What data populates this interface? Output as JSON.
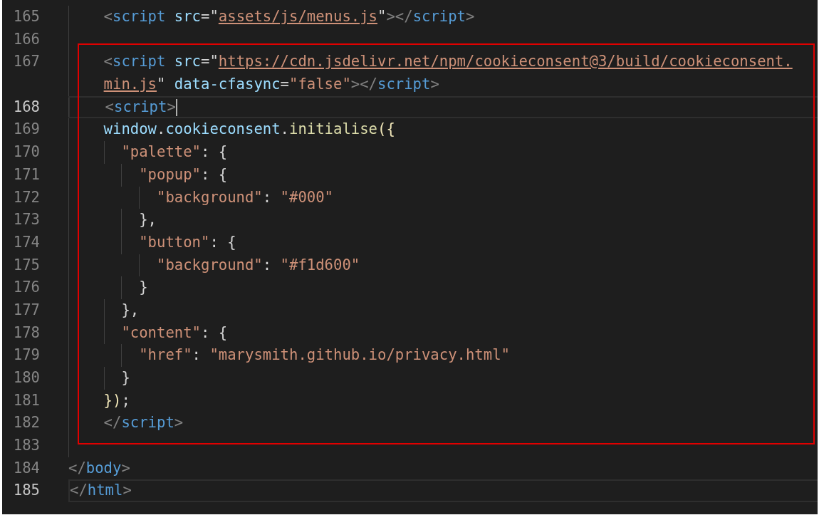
{
  "editor": {
    "blocks": [
      {
        "kind": "plain",
        "lines": [
          {
            "number": "165",
            "current": false,
            "caret": false,
            "tokens": [
              {
                "kind": "punct",
                "text": "    <"
              },
              {
                "kind": "tag",
                "text": "script"
              },
              {
                "kind": "attr",
                "text": " src"
              },
              {
                "kind": "plain",
                "text": "=\""
              },
              {
                "kind": "link",
                "text": "assets/js/menus.js"
              },
              {
                "kind": "plain",
                "text": "\""
              },
              {
                "kind": "punct",
                "text": "></"
              },
              {
                "kind": "tag",
                "text": "script"
              },
              {
                "kind": "punct",
                "text": ">"
              }
            ]
          },
          {
            "number": "166",
            "current": false,
            "caret": false
          }
        ]
      },
      {
        "kind": "framed",
        "lines": [
          {
            "number": "167",
            "current": false,
            "caret": false,
            "tokens": [
              {
                "kind": "punct",
                "text": "    <"
              },
              {
                "kind": "tag",
                "text": "script"
              },
              {
                "kind": "attr",
                "text": " src"
              },
              {
                "kind": "plain",
                "text": "=\""
              },
              {
                "kind": "link",
                "text": "https://cdn.jsdelivr.net/npm/cookieconsent@3/build/cookieconsent."
              }
            ],
            "wrap_tokens": [
              {
                "kind": "link",
                "text": "    min.js"
              },
              {
                "kind": "plain",
                "text": "\""
              },
              {
                "kind": "attr",
                "text": " data-cfasync"
              },
              {
                "kind": "plain",
                "text": "="
              },
              {
                "kind": "string",
                "text": "\"false\""
              },
              {
                "kind": "punct",
                "text": "></"
              },
              {
                "kind": "tag",
                "text": "script"
              },
              {
                "kind": "punct",
                "text": ">"
              }
            ]
          },
          {
            "number": "168",
            "current": true,
            "caret": true,
            "tokens": [
              {
                "kind": "punct",
                "text": "    <"
              },
              {
                "kind": "tag",
                "text": "script"
              },
              {
                "kind": "punct",
                "text": ">"
              }
            ]
          },
          {
            "number": "169",
            "current": false,
            "caret": false,
            "tokens": [
              {
                "kind": "var",
                "text": "    window"
              },
              {
                "kind": "plain",
                "text": "."
              },
              {
                "kind": "var",
                "text": "cookieconsent"
              },
              {
                "kind": "plain",
                "text": "."
              },
              {
                "kind": "func",
                "text": "initialise"
              },
              {
                "kind": "bracket",
                "text": "({"
              }
            ]
          },
          {
            "number": "170",
            "current": false,
            "caret": false,
            "tokens": [
              {
                "kind": "string",
                "text": "      \"palette\""
              },
              {
                "kind": "plain",
                "text": ": {"
              }
            ]
          },
          {
            "number": "171",
            "current": false,
            "caret": false,
            "tokens": [
              {
                "kind": "string",
                "text": "        \"popup\""
              },
              {
                "kind": "plain",
                "text": ": {"
              }
            ]
          },
          {
            "number": "172",
            "current": false,
            "caret": false,
            "tokens": [
              {
                "kind": "string",
                "text": "          \"background\""
              },
              {
                "kind": "plain",
                "text": ": "
              },
              {
                "kind": "string",
                "text": "\"#000\""
              }
            ]
          },
          {
            "number": "173",
            "current": false,
            "caret": false,
            "tokens": [
              {
                "kind": "plain",
                "text": "        },"
              }
            ]
          },
          {
            "number": "174",
            "current": false,
            "caret": false,
            "tokens": [
              {
                "kind": "string",
                "text": "        \"button\""
              },
              {
                "kind": "plain",
                "text": ": {"
              }
            ]
          },
          {
            "number": "175",
            "current": false,
            "caret": false,
            "tokens": [
              {
                "kind": "string",
                "text": "          \"background\""
              },
              {
                "kind": "plain",
                "text": ": "
              },
              {
                "kind": "string",
                "text": "\"#f1d600\""
              }
            ]
          },
          {
            "number": "176",
            "current": false,
            "caret": false,
            "tokens": [
              {
                "kind": "plain",
                "text": "        }"
              }
            ]
          },
          {
            "number": "177",
            "current": false,
            "caret": false,
            "tokens": [
              {
                "kind": "plain",
                "text": "      },"
              }
            ]
          },
          {
            "number": "178",
            "current": false,
            "caret": false,
            "tokens": [
              {
                "kind": "string",
                "text": "      \"content\""
              },
              {
                "kind": "plain",
                "text": ": {"
              }
            ]
          },
          {
            "number": "179",
            "current": false,
            "caret": false,
            "tokens": [
              {
                "kind": "string",
                "text": "        \"href\""
              },
              {
                "kind": "plain",
                "text": ": "
              },
              {
                "kind": "string",
                "text": "\"marysmith.github.io/privacy.html\""
              }
            ]
          },
          {
            "number": "180",
            "current": false,
            "caret": false,
            "tokens": [
              {
                "kind": "plain",
                "text": "      }"
              }
            ]
          },
          {
            "number": "181",
            "current": false,
            "caret": false,
            "tokens": [
              {
                "kind": "bracket",
                "text": "    })"
              },
              {
                "kind": "plain",
                "text": ";"
              }
            ]
          },
          {
            "number": "182",
            "current": false,
            "caret": false,
            "tokens": [
              {
                "kind": "punct",
                "text": "    </"
              },
              {
                "kind": "tag",
                "text": "script"
              },
              {
                "kind": "punct",
                "text": ">"
              }
            ]
          }
        ]
      },
      {
        "kind": "plain",
        "lines": [
          {
            "number": "183",
            "current": false,
            "caret": false
          },
          {
            "number": "184",
            "current": false,
            "caret": false,
            "tokens": [
              {
                "kind": "punct",
                "text": "</"
              },
              {
                "kind": "tag",
                "text": "body"
              },
              {
                "kind": "punct",
                "text": ">"
              }
            ]
          },
          {
            "number": "185",
            "current": true,
            "caret": false,
            "tokens": [
              {
                "kind": "punct",
                "text": "</"
              },
              {
                "kind": "tag",
                "text": "html"
              },
              {
                "kind": "punct",
                "text": ">"
              }
            ]
          }
        ]
      }
    ]
  }
}
